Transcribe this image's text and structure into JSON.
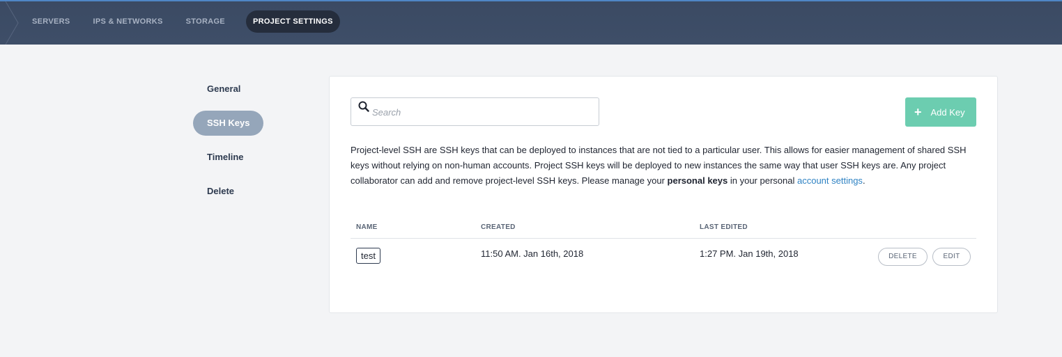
{
  "nav": {
    "items": [
      {
        "label": "SERVERS"
      },
      {
        "label": "IPS & NETWORKS"
      },
      {
        "label": "STORAGE"
      },
      {
        "label": "PROJECT SETTINGS"
      }
    ]
  },
  "sidebar": {
    "items": [
      {
        "label": "General"
      },
      {
        "label": "SSH Keys"
      },
      {
        "label": "Timeline"
      },
      {
        "label": "Delete"
      }
    ],
    "active": "SSH Keys"
  },
  "search": {
    "placeholder": "Search",
    "value": ""
  },
  "add_key": {
    "label": "Add Key",
    "icon": "plus-icon"
  },
  "description": {
    "text_1": "Project-level SSH are SSH keys that can be deployed to instances that are not tied to a particular user. This allows for easier management of shared SSH keys without relying on non-human accounts. Project SSH keys will be deployed to new instances the same way that user SSH keys are. Any project collaborator can add and remove project-level SSH keys. Please manage your ",
    "bold": "personal keys",
    "text_2": " in your personal ",
    "link": "account settings",
    "text_3": "."
  },
  "table": {
    "headers": {
      "name": "NAME",
      "created": "CREATED",
      "last_edited": "LAST EDITED"
    },
    "rows": [
      {
        "name": "test",
        "created": "11:50 AM. Jan 16th, 2018",
        "last_edited": "1:27 PM. Jan 19th, 2018",
        "delete_label": "DELETE",
        "edit_label": "EDIT"
      }
    ]
  },
  "colors": {
    "topbar": "#3e4e68",
    "active_nav": "#252d3c",
    "accent_add": "#6ccdb0",
    "link": "#2e82c3",
    "side_active": "#95a6ba"
  }
}
